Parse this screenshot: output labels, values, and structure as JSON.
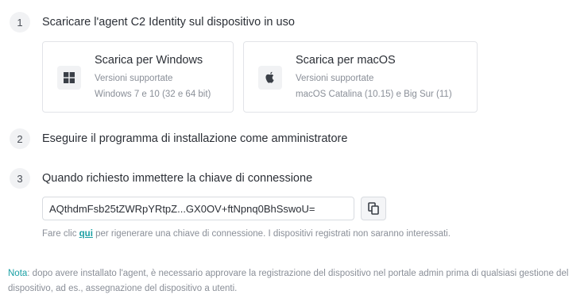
{
  "steps": [
    {
      "number": "1",
      "title": "Scaricare l'agent C2 Identity sul dispositivo in uso"
    },
    {
      "number": "2",
      "title": "Eseguire il programma di installazione come amministratore"
    },
    {
      "number": "3",
      "title": "Quando richiesto immettere la chiave di connessione"
    }
  ],
  "downloads": {
    "windows": {
      "title": "Scarica per Windows",
      "supported_label": "Versioni supportate",
      "versions": "Windows 7 e 10 (32 e 64 bit)",
      "icon": "windows-icon"
    },
    "macos": {
      "title": "Scarica per macOS",
      "supported_label": "Versioni supportate",
      "versions": "macOS Catalina (10.15) e Big Sur (11)",
      "icon": "apple-icon"
    }
  },
  "connection_key": {
    "value": "AQthdmFsb25tZWRpYRtpZ...GX0OV+ftNpnq0BhSswoU=",
    "copy_icon": "copy-icon"
  },
  "regenerate_hint": {
    "before": "Fare clic ",
    "link": "qui",
    "after": " per rigenerare una chiave di connessione. I dispositivi registrati non saranno interessati."
  },
  "note": {
    "label": "Nota",
    "text": ": dopo avere installato l'agent, è necessario approvare la registrazione del dispositivo nel portale admin prima di qualsiasi gestione del dispositivo, ad es., assegnazione del dispositivo a utenti."
  },
  "colors": {
    "accent": "#1a9fa3",
    "text": "#2b2f36",
    "muted": "#8a8f98",
    "border": "#e2e4e8"
  }
}
